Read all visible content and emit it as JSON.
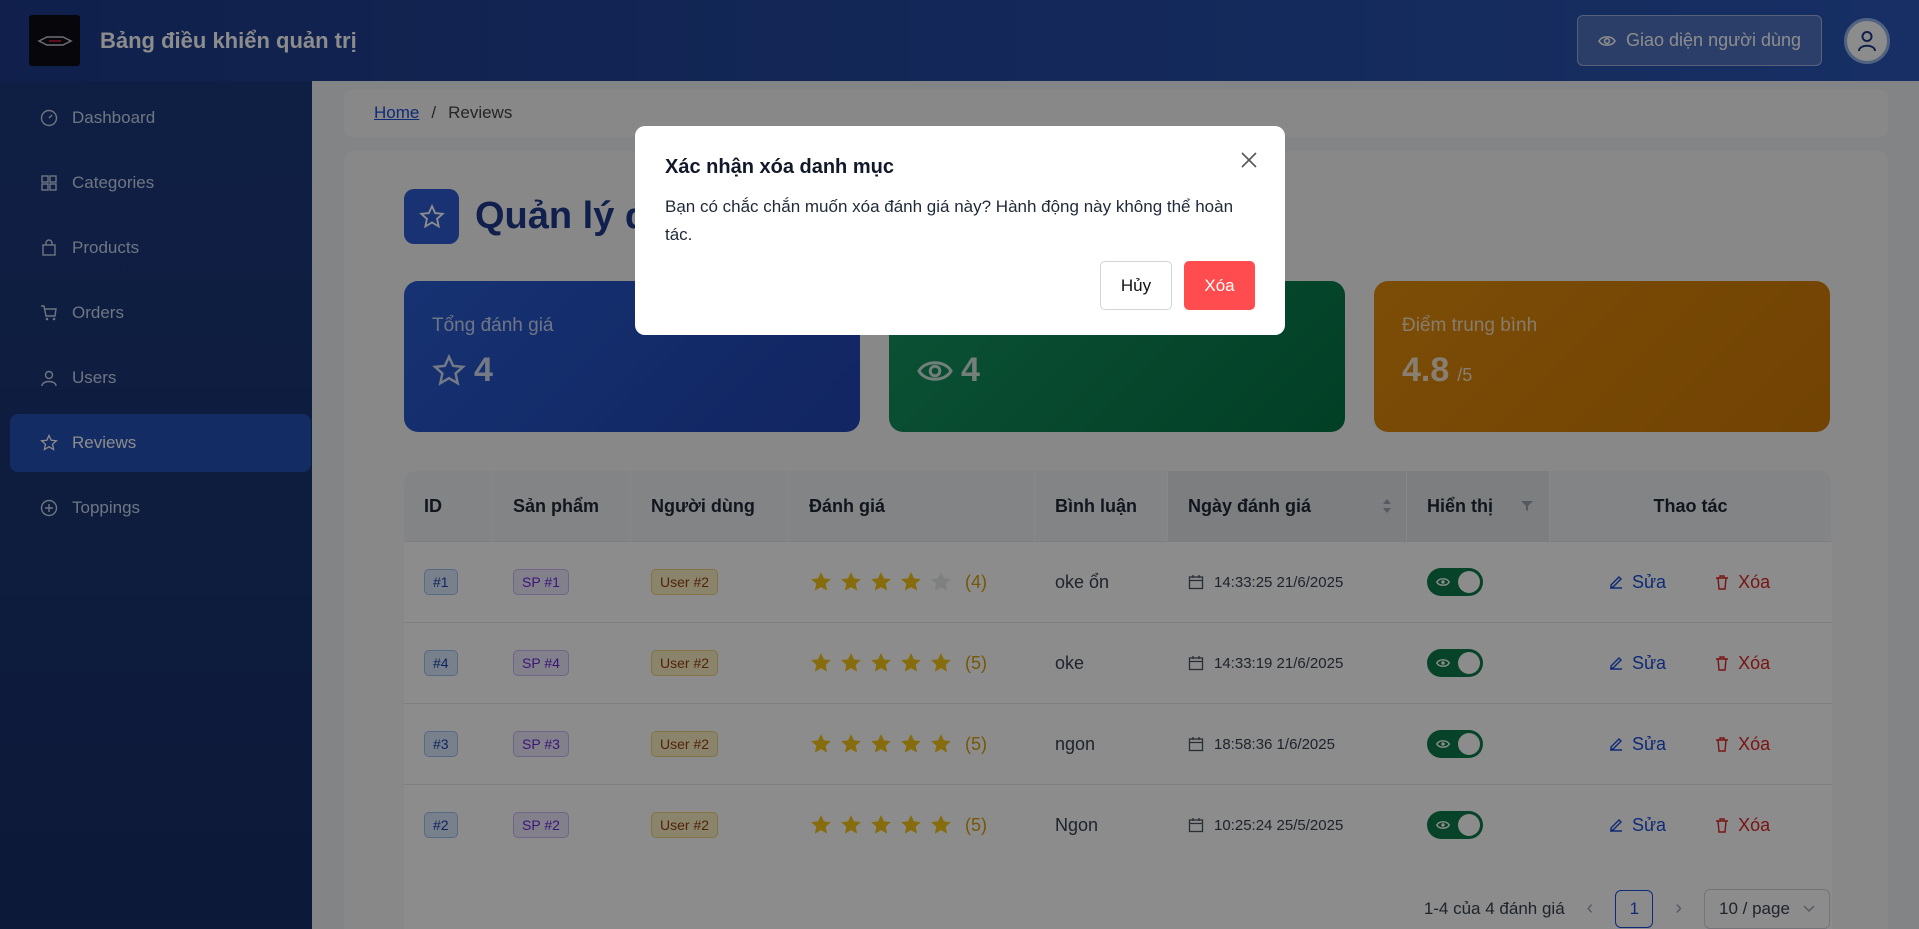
{
  "header": {
    "title": "Bảng điều khiển quản trị",
    "user_view_label": "Giao diện người dùng"
  },
  "sidebar": {
    "items": [
      {
        "label": "Dashboard",
        "icon": "dashboard-icon"
      },
      {
        "label": "Categories",
        "icon": "grid-icon"
      },
      {
        "label": "Products",
        "icon": "bag-icon"
      },
      {
        "label": "Orders",
        "icon": "cart-icon"
      },
      {
        "label": "Users",
        "icon": "user-icon"
      },
      {
        "label": "Reviews",
        "icon": "star-icon",
        "active": true
      },
      {
        "label": "Toppings",
        "icon": "plus-circle-icon"
      }
    ]
  },
  "breadcrumb": {
    "home": "Home",
    "separator": "/",
    "current": "Reviews"
  },
  "page": {
    "title_visible": "Quản lý đ"
  },
  "stats": {
    "total": {
      "label": "Tổng đánh giá",
      "value": "4"
    },
    "visible": {
      "value": "4"
    },
    "average": {
      "label": "Điểm trung bình",
      "value": "4.8",
      "unit": "/5"
    }
  },
  "table": {
    "columns": [
      "ID",
      "Sản phẩm",
      "Người dùng",
      "Đánh giá",
      "Bình luận",
      "Ngày đánh giá",
      "Hiển thị",
      "Thao tác"
    ],
    "rows": [
      {
        "id": "#1",
        "product": "SP #1",
        "user": "User #2",
        "rating": 4,
        "rating_text": "(4)",
        "comment": "oke ổn",
        "date": "14:33:25 21/6/2025",
        "visible": true
      },
      {
        "id": "#4",
        "product": "SP #4",
        "user": "User #2",
        "rating": 5,
        "rating_text": "(5)",
        "comment": "oke",
        "date": "14:33:19 21/6/2025",
        "visible": true
      },
      {
        "id": "#3",
        "product": "SP #3",
        "user": "User #2",
        "rating": 5,
        "rating_text": "(5)",
        "comment": "ngon",
        "date": "18:58:36 1/6/2025",
        "visible": true
      },
      {
        "id": "#2",
        "product": "SP #2",
        "user": "User #2",
        "rating": 5,
        "rating_text": "(5)",
        "comment": "Ngon",
        "date": "10:25:24 25/5/2025",
        "visible": true
      }
    ],
    "edit_label": "Sửa",
    "delete_label": "Xóa"
  },
  "pagination": {
    "summary": "1-4 của 4 đánh giá",
    "current_page": "1",
    "page_size": "10 / page"
  },
  "modal": {
    "title": "Xác nhận xóa danh mục",
    "body": "Bạn có chắc chắn muốn xóa đánh giá này? Hành động này không thể hoàn tác.",
    "cancel_label": "Hủy",
    "confirm_label": "Xóa"
  },
  "colors": {
    "primary": "#1e3a8a",
    "danger": "#ff4d4f",
    "success": "#0b7a4b",
    "warning": "#e18d0d",
    "star": "#f5c518"
  }
}
